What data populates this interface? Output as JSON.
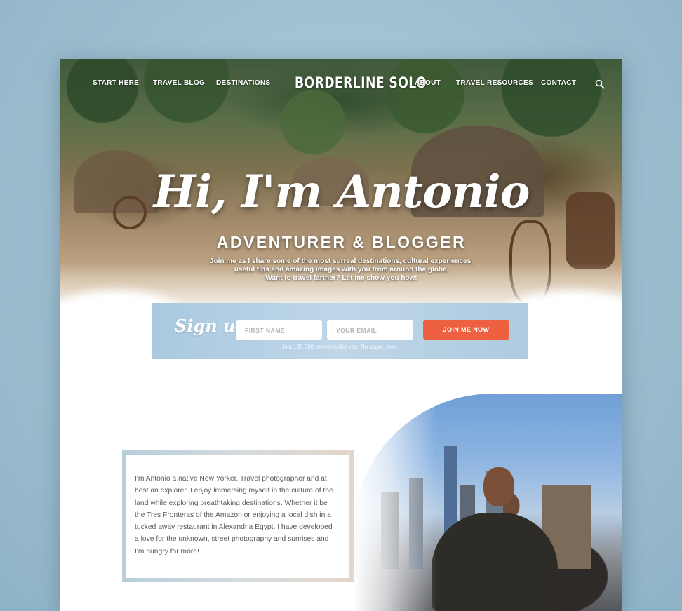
{
  "nav": {
    "left_items": [
      {
        "label": "START HERE"
      },
      {
        "label": "TRAVEL BLOG"
      },
      {
        "label": "DESTINATIONS"
      }
    ],
    "logo": "BORDERLINE SOLO",
    "right_items": [
      {
        "label": "ABOUT"
      },
      {
        "label": "TRAVEL RESOURCES"
      },
      {
        "label": "CONTACT"
      }
    ],
    "search_icon": "search-icon"
  },
  "hero": {
    "title": "Hi, I'm Antonio",
    "subtitle": "ADVENTURER & BLOGGER",
    "description_lines": [
      "Join me as I share some of the most surreal destinations, cultural experiences,",
      "useful tips and amazing images with you from around the globe.",
      "Want to travel farther? Let me show you how!"
    ]
  },
  "signup": {
    "title": "Sign up",
    "first_name_placeholder": "FIRST NAME",
    "email_placeholder": "YOUR EMAIL",
    "button_label": "JOIN ME NOW",
    "note": "Join 180,000 travelers like you. No spam, ever."
  },
  "about": {
    "lines": [
      "I'm Antonio a native New Yorker, Travel photographer and at",
      "best an explorer. I enjoy immersing myself in the culture of the",
      "land while exploring breathtaking destinations. Whether it be",
      "the Tres Fronteras of the Amazon or enjoying a local dish in a",
      "tucked away restaurant in Alexandria Egypt. I have developed",
      "a love for the unknown, street photography and sunrises and",
      "I'm hungry for more!"
    ]
  },
  "colors": {
    "accent": "#ee6140",
    "signup_bg": "#bfd6e8",
    "page_bg": "#9dbfd0"
  }
}
